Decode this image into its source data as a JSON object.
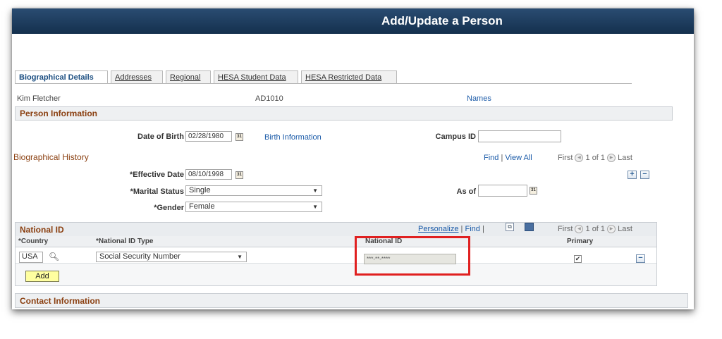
{
  "page": {
    "title": "Add/Update a Person"
  },
  "tabs": [
    {
      "label": "Biographical Details"
    },
    {
      "label": "Addresses"
    },
    {
      "label": "Regional"
    },
    {
      "label": "HESA Student Data"
    },
    {
      "label": "HESA Restricted Data"
    }
  ],
  "person": {
    "name": "Kim Fletcher",
    "id": "AD1010",
    "names_link": "Names"
  },
  "person_info": {
    "section_title": "Person Information",
    "dob_label": "Date of Birth",
    "dob_value": "02/28/1980",
    "birth_info_link": "Birth Information",
    "campus_id_label": "Campus ID",
    "campus_id_value": ""
  },
  "bio_history": {
    "title": "Biographical History",
    "find": "Find",
    "sep": "|",
    "view_all": "View All",
    "first": "First",
    "counter": "1 of 1",
    "last": "Last",
    "eff_date_label": "*Effective Date",
    "eff_date_value": "08/10/1998",
    "marital_label": "*Marital Status",
    "marital_value": "Single",
    "as_of_label": "As of",
    "as_of_value": "",
    "gender_label": "*Gender",
    "gender_value": "Female"
  },
  "national_id": {
    "section_title": "National ID",
    "personalize": "Personalize",
    "sep": "|",
    "find": "Find",
    "first": "First",
    "counter": "1 of 1",
    "last": "Last",
    "col_country": "*Country",
    "col_type": "*National ID Type",
    "col_id": "National ID",
    "col_primary": "Primary",
    "row": {
      "country": "USA",
      "type": "Social Security Number",
      "id": "***-**-****",
      "primary": true
    },
    "add_label": "Add"
  },
  "contact": {
    "section_title": "Contact Information"
  },
  "icons": {
    "add_row": "plus-icon",
    "delete_row": "minus-icon",
    "calendar": "calendar-icon",
    "lookup": "magnifier-icon"
  },
  "colors": {
    "header": "#1c3a5e",
    "highlight": "#e02020",
    "section_title": "#8a3f10",
    "link": "#1a5aa8"
  }
}
